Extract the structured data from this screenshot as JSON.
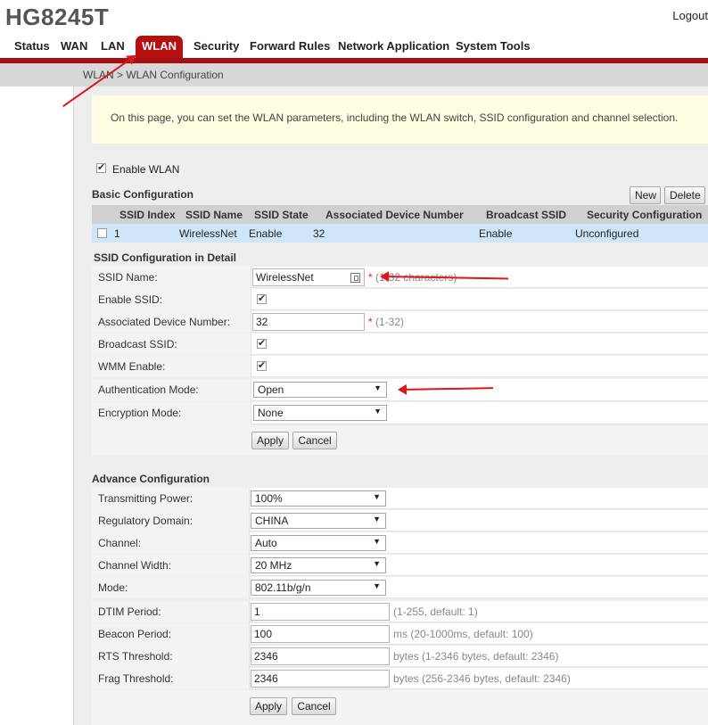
{
  "header": {
    "brand": "HG8245T",
    "logout": "Logout"
  },
  "nav": {
    "items": [
      {
        "label": "Status"
      },
      {
        "label": "WAN"
      },
      {
        "label": "LAN"
      },
      {
        "label": "WLAN",
        "active": true
      },
      {
        "label": "Security"
      },
      {
        "label": "Forward Rules"
      },
      {
        "label": "Network Application"
      },
      {
        "label": "System Tools"
      }
    ]
  },
  "breadcrumb": "WLAN > WLAN Configuration",
  "info": "On this page, you can set the WLAN parameters, including the WLAN switch, SSID configuration and channel selection.",
  "enable_wlan": {
    "label": "Enable WLAN",
    "checked": true
  },
  "basic": {
    "title": "Basic Configuration",
    "new_label": "New",
    "delete_label": "Delete",
    "columns": [
      "SSID Index",
      "SSID Name",
      "SSID State",
      "Associated Device Number",
      "Broadcast SSID",
      "Security Configuration"
    ],
    "row": [
      "1",
      "WirelessNet",
      "Enable",
      "32",
      "Enable",
      "Unconfigured"
    ]
  },
  "detail": {
    "title": "SSID Configuration in Detail",
    "ssid_name_label": "SSID Name:",
    "ssid_name_value": "WirelessNet",
    "ssid_name_hint": "(1-32 characters)",
    "enable_ssid_label": "Enable SSID:",
    "assoc_label": "Associated Device Number:",
    "assoc_value": "32",
    "assoc_hint": "(1-32)",
    "broadcast_label": "Broadcast SSID:",
    "wmm_label": "WMM Enable:",
    "auth_label": "Authentication Mode:",
    "auth_value": "Open",
    "enc_label": "Encryption Mode:",
    "enc_value": "None",
    "req_mark": "*",
    "apply_label": "Apply",
    "cancel_label": "Cancel"
  },
  "advance": {
    "title": "Advance Configuration",
    "power_label": "Transmitting Power:",
    "power_value": "100%",
    "domain_label": "Regulatory Domain:",
    "domain_value": "CHINA",
    "channel_label": "Channel:",
    "channel_value": "Auto",
    "width_label": "Channel Width:",
    "width_value": "20 MHz",
    "mode_label": "Mode:",
    "mode_value": "802.11b/g/n",
    "dtim_label": "DTIM Period:",
    "dtim_value": "1",
    "dtim_hint": "(1-255, default: 1)",
    "beacon_label": "Beacon Period:",
    "beacon_value": "100",
    "beacon_hint": "ms (20-1000ms, default: 100)",
    "rts_label": "RTS Threshold:",
    "rts_value": "2346",
    "rts_hint": "bytes (1-2346 bytes, default: 2346)",
    "frag_label": "Frag Threshold:",
    "frag_value": "2346",
    "frag_hint": "bytes (256-2346 bytes, default: 2346)",
    "apply_label": "Apply",
    "cancel_label": "Cancel"
  },
  "colors": {
    "accent": "#b50f0f",
    "info_bg": "#fffde2",
    "row_highlight": "#cfe6f9",
    "annotation_arrow": "#d8181c"
  }
}
